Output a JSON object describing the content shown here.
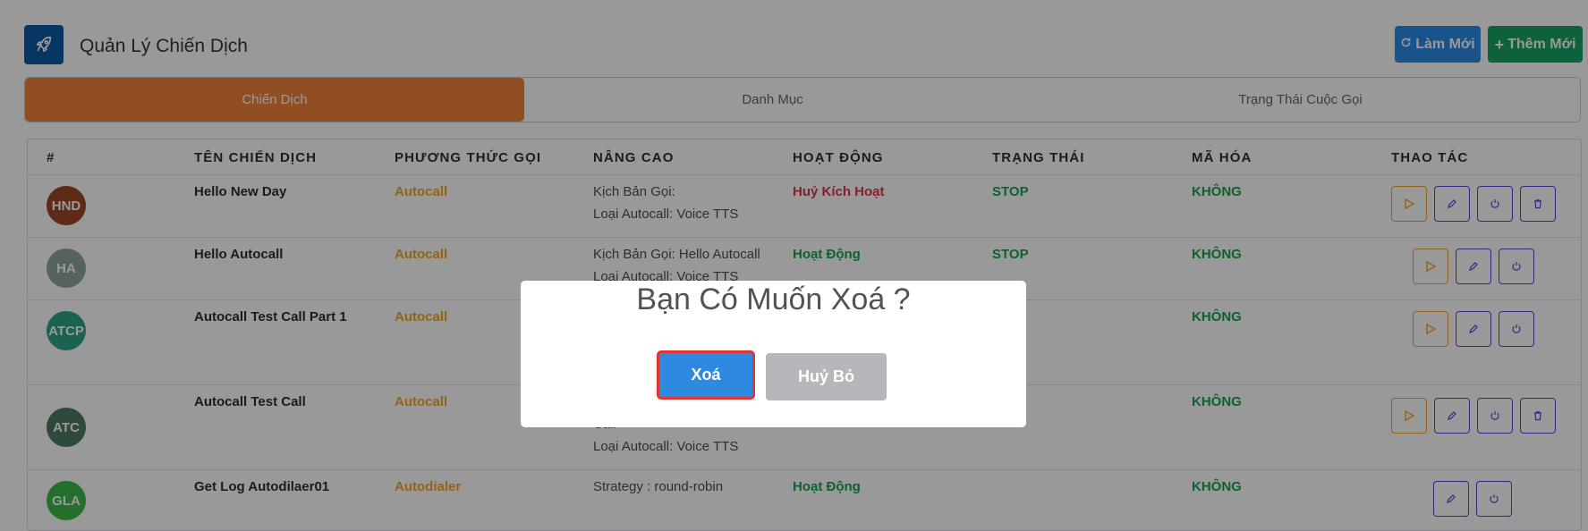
{
  "header": {
    "title": "Quản Lý Chiến Dịch",
    "refresh_label": "Làm Mới",
    "add_label": "Thêm Mới"
  },
  "tabs": [
    {
      "label": "Chiến Dịch"
    },
    {
      "label": "Danh Mục"
    },
    {
      "label": "Trạng Thái Cuộc Gọi"
    }
  ],
  "table": {
    "columns": [
      "#",
      "TÊN CHIẾN DỊCH",
      "PHƯƠNG THỨC GỌI",
      "NÂNG CAO",
      "HOẠT ĐỘNG",
      "TRẠNG THÁI",
      "MÃ HÓA",
      "THAO TÁC"
    ],
    "rows": [
      {
        "initials": "HND",
        "avatar_color": "#a0462a",
        "name": "Hello New Day",
        "method": "Autocall",
        "adv1": "Kịch Bản Gọi:",
        "adv2": "Loại Autocall: Voice TTS",
        "activity": "Huỷ Kích Hoạt",
        "status": "STOP",
        "encrypt": "KHÔNG"
      },
      {
        "initials": "HA",
        "avatar_color": "#8fa4a1",
        "name": "Hello Autocall",
        "method": "Autocall",
        "adv1": "Kịch Bản Gọi: Hello Autocall",
        "adv2": "Loại Autocall: Voice TTS",
        "activity": "Hoạt Động",
        "status": "STOP",
        "encrypt": "KHÔNG"
      },
      {
        "initials": "ATCP",
        "avatar_color": "#2fa48a",
        "name": "Autocall Test Call Part 1",
        "method": "Autocall",
        "adv1": "",
        "adv2": "",
        "activity": "",
        "status": "",
        "encrypt": "KHÔNG"
      },
      {
        "initials": "ATC",
        "avatar_color": "#4f7a62",
        "name": "Autocall Test Call",
        "method": "Autocall",
        "adv1": "Call",
        "adv2": "Loại Autocall: Voice TTS",
        "activity": "",
        "status": "",
        "encrypt": "KHÔNG"
      },
      {
        "initials": "GLA",
        "avatar_color": "#3cba48",
        "name": "Get Log Autodilaer01",
        "method": "Autodialer",
        "adv1": "Strategy : round-robin",
        "adv2": "",
        "activity": "Hoạt Động",
        "status": "",
        "encrypt": "KHÔNG"
      }
    ]
  },
  "modal": {
    "title": "Bạn Có Muốn Xoá ?",
    "confirm_label": "Xoá",
    "cancel_label": "Huỷ Bỏ"
  },
  "colors": {
    "accent_tab": "#f08239",
    "primary": "#2b8ae6",
    "success": "#17a365",
    "warning": "#f5a623",
    "danger": "#dc3545"
  }
}
